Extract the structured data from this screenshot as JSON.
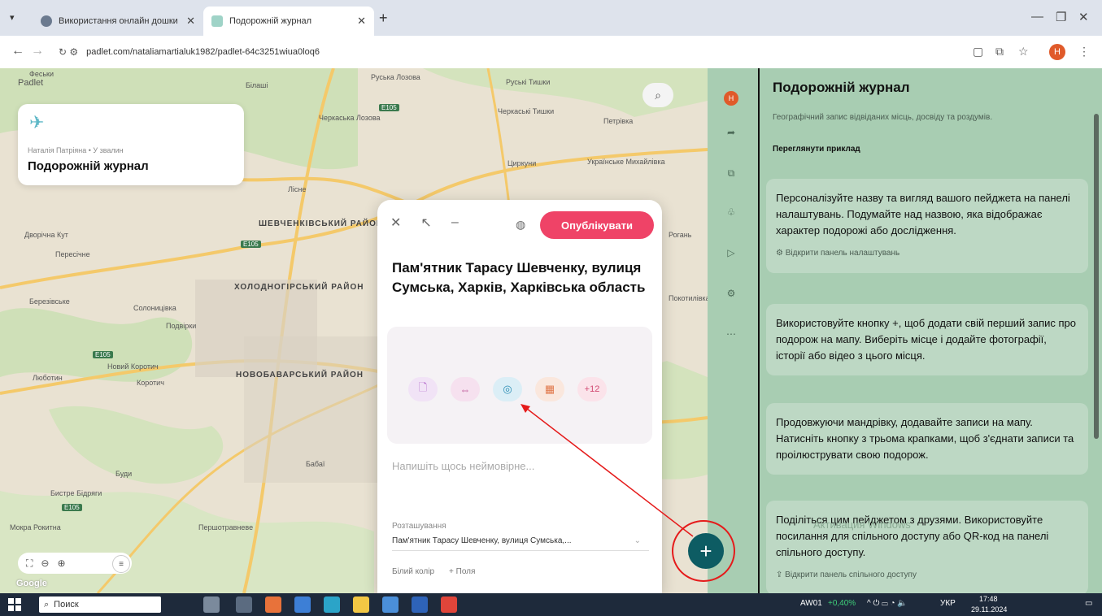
{
  "browser": {
    "tabs": [
      {
        "title": "Використання онлайн дошки",
        "active": false
      },
      {
        "title": "Подорожній журнал",
        "active": true
      }
    ],
    "url": "padlet.com/nataliamartialuk1982/padlet-64c3251wiua0loq6",
    "profile_initial": "Н"
  },
  "map": {
    "brand": "Padlet",
    "card": {
      "author": "Наталія Патріяна • У звалин",
      "title": "Подорожній журнал"
    },
    "labels": [
      "Феськи",
      "Білаші",
      "Руська Лозова",
      "Руські Тишки",
      "Черкаська Лозова",
      "Черкаські Тишки",
      "Петрівка",
      "Циркуни",
      "Українське Михайлівка",
      "Дворічна Кут",
      "Пересічне",
      "ШЕВЧЕНКІВСЬКИЙ РАЙОН",
      "ХОЛОДНОГІРСЬКИЙ РАЙОН",
      "Солоницівка",
      "Подвірки",
      "Новий Коротич",
      "Коротич",
      "Люботин",
      "НОВОБАВАРСЬКИЙ РАЙОН",
      "Бабаї",
      "Буди",
      "Бистре Бідряги",
      "Першотравневе",
      "Рогань",
      "Покотилівка",
      "Мокра Рокитна",
      "Березівське",
      "Лісне"
    ],
    "attribution": "Google"
  },
  "editor": {
    "publish_label": "Опублікувати",
    "post_title": "Пам'ятник Тарасу Шевченку, вулиця Сумська, Харків, Харківська область",
    "attach_more": "+12",
    "body_placeholder": "Напишіть щось неймовірне...",
    "location_label": "Розташування",
    "location_value": "Пам'ятник Тарасу Шевченку, вулиця Сумська,...",
    "color_label": "Білий колір",
    "fields_label": "+ Поля"
  },
  "panel": {
    "title": "Подорожній журнал",
    "description": "Географічний запис відвіданих місць, досвіду та роздумів.",
    "example_link": "Переглянути приклад",
    "tips": [
      {
        "text": "Персоналізуйте назву та вигляд вашого пейджета на панелі налаштувань. Подумайте над назвою, яка відображає характер подорожі або дослідження.",
        "link": "Відкрити панель налаштувань"
      },
      {
        "text": "Використовуйте кнопку +, щоб додати свій перший запис про подорож на мапу. Виберіть місце і додайте фотографії, історії або відео з цього місця.",
        "link": ""
      },
      {
        "text": "Продовжуючи мандрівку, додавайте записи на мапу. Натисніть кнопку з трьома крапками, щоб з'єднати записи та проілюструвати свою подорож.",
        "link": ""
      },
      {
        "text": "Поділіться цим пейджетом з друзями. Використовуйте посилання для спільного доступу або QR-код на панелі спільного доступу.",
        "link": "Відкрити панель спільного доступу"
      }
    ],
    "watermark": "Активация Windows"
  },
  "taskbar": {
    "search": "Поиск",
    "ticker": "AW01",
    "ticker_change": "+0,40%",
    "lang": "УКР",
    "time": "17:48",
    "date": "29.11.2024"
  },
  "colors": {
    "publish": "#ef4367",
    "fab": "#0d5c63",
    "panel_bg": "#a8cdb2",
    "annotation": "#e51b1b"
  }
}
